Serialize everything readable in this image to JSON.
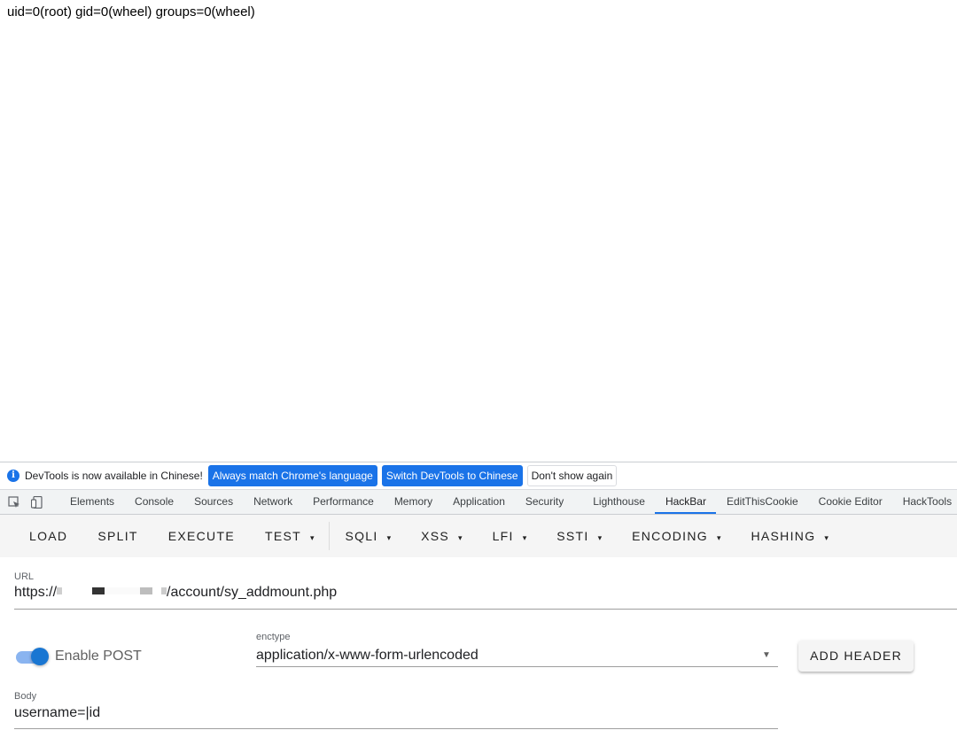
{
  "page": {
    "output": "uid=0(root) gid=0(wheel) groups=0(wheel)"
  },
  "infobar": {
    "icon": "info-icon",
    "message": "DevTools is now available in Chinese!",
    "btn_match": "Always match Chrome's language",
    "btn_switch": "Switch DevTools to Chinese",
    "btn_dismiss": "Don't show again"
  },
  "tabbar": {
    "icons": [
      "inspect-element-icon",
      "device-toolbar-icon"
    ],
    "tabs": [
      "Elements",
      "Console",
      "Sources",
      "Network",
      "Performance",
      "Memory",
      "Application",
      "Security",
      "Lighthouse",
      "HackBar",
      "EditThisCookie",
      "Cookie Editor",
      "HackTools"
    ],
    "active": "HackBar"
  },
  "hackbar": {
    "buttons": {
      "load": "LOAD",
      "split": "SPLIT",
      "execute": "EXECUTE",
      "test": "TEST",
      "sqli": "SQLI",
      "xss": "XSS",
      "lfi": "LFI",
      "ssti": "SSTI",
      "encoding": "ENCODING",
      "hashing": "HASHING"
    },
    "caret": "▾",
    "url_label": "URL",
    "url_prefix": "https://",
    "url_suffix": "/account/sy_addmount.php",
    "enable_post_label": "Enable POST",
    "enable_post": true,
    "enctype_label": "enctype",
    "enctype_value": "application/x-www-form-urlencoded",
    "add_header": "ADD HEADER",
    "body_label": "Body",
    "body_value": "username=|id"
  },
  "colors": {
    "accent": "#1a73e8",
    "switch_thumb": "#1976d2",
    "toolbar_bg": "#f5f5f5"
  }
}
